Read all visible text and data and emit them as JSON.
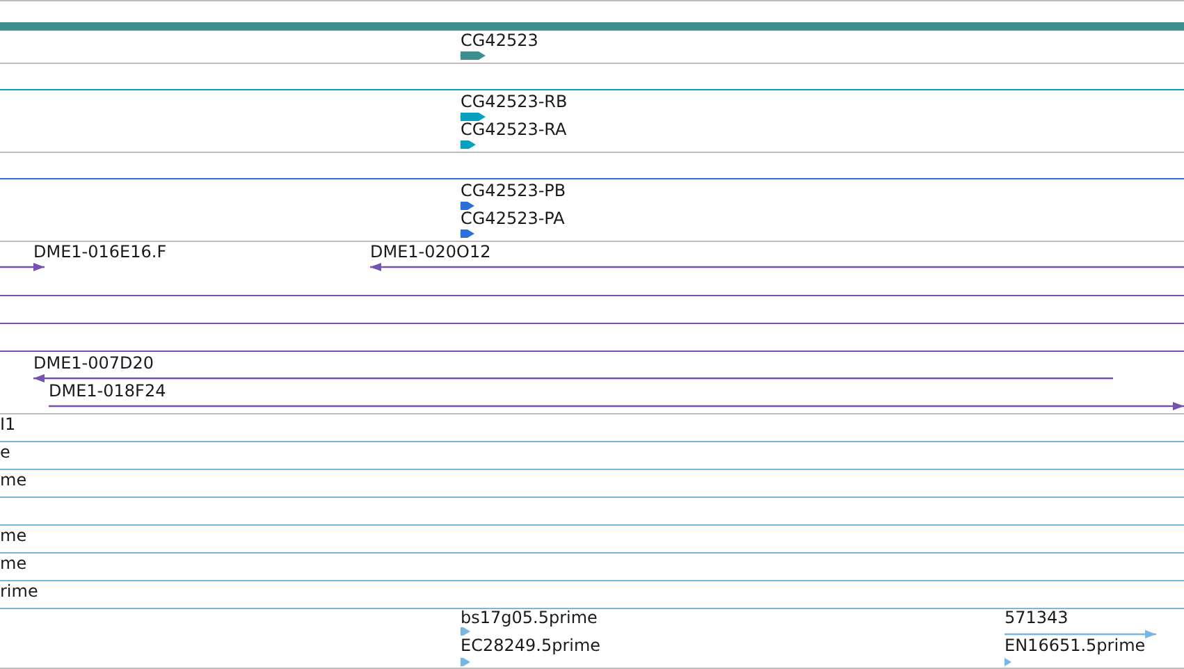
{
  "tracks": [
    {
      "kind": "gene",
      "color": "#3f8f91",
      "features": [
        {
          "label": "CG42523",
          "kind": "arrow",
          "forward": true
        }
      ]
    },
    {
      "kind": "transcript",
      "color": "#0aa0c0",
      "features": [
        {
          "label": "CG42523-RB",
          "kind": "arrow",
          "forward": true
        },
        {
          "label": "CG42523-RA",
          "kind": "arrow",
          "forward": true
        }
      ]
    },
    {
      "kind": "protein",
      "color": "#2d6fd6",
      "features": [
        {
          "label": "CG42523-PB",
          "kind": "arrow",
          "forward": true
        },
        {
          "label": "CG42523-PA",
          "kind": "arrow",
          "forward": true
        }
      ]
    },
    {
      "kind": "clone",
      "color": "#7652b0",
      "features": [
        {
          "label": "DME1-016E16.F",
          "kind": "line",
          "forward": true
        },
        {
          "label": "DME1-020O12",
          "kind": "line",
          "forward": false
        },
        {
          "label": "DME1-007D20",
          "kind": "line",
          "forward": false
        },
        {
          "label": "DME1-018F24",
          "kind": "line",
          "forward": true
        }
      ]
    },
    {
      "kind": "est",
      "color": "#7ab6e0",
      "features": [
        {
          "label": "I1",
          "kind": "label"
        },
        {
          "label": "e",
          "kind": "label"
        },
        {
          "label": "me",
          "kind": "label"
        },
        {
          "label": "me",
          "kind": "label"
        },
        {
          "label": "me",
          "kind": "label"
        },
        {
          "label": "rime",
          "kind": "label"
        },
        {
          "label": "bs17g05.5prime",
          "kind": "arrow",
          "forward": true
        },
        {
          "label": "EC28249.5prime",
          "kind": "arrow",
          "forward": true
        },
        {
          "label": "571343",
          "kind": "line",
          "forward": true
        },
        {
          "label": "EN16651.5prime",
          "kind": "arrow",
          "forward": true
        }
      ]
    }
  ]
}
